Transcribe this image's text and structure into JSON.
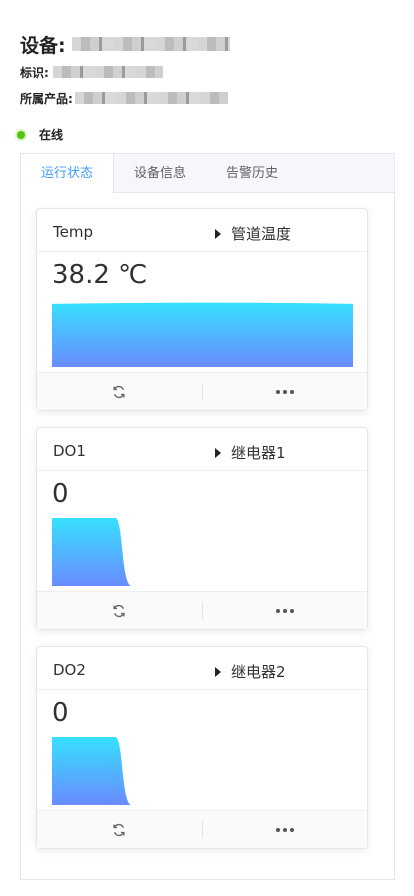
{
  "header": {
    "device_label": "设备:",
    "id_label": "标识:",
    "product_label": "所属产品:"
  },
  "status": {
    "text": "在线",
    "color": "#52c41a"
  },
  "tabs": [
    {
      "label": "运行状态",
      "active": true
    },
    {
      "label": "设备信息",
      "active": false
    },
    {
      "label": "告警历史",
      "active": false
    }
  ],
  "accent_color": "#409eff",
  "cards": [
    {
      "name": "Temp",
      "link": "管道温度",
      "value": "38.2 ℃",
      "level_fraction": 0.95,
      "fill_fraction": 1.0
    },
    {
      "name": "DO1",
      "link": "继电器1",
      "value": "0",
      "level_fraction": 1.0,
      "fill_fraction": 0.25
    },
    {
      "name": "DO2",
      "link": "继电器2",
      "value": "0",
      "level_fraction": 1.0,
      "fill_fraction": 0.25
    }
  ],
  "icons": {
    "refresh": "refresh-icon",
    "more": "more-icon",
    "play": "caret-right-icon"
  }
}
